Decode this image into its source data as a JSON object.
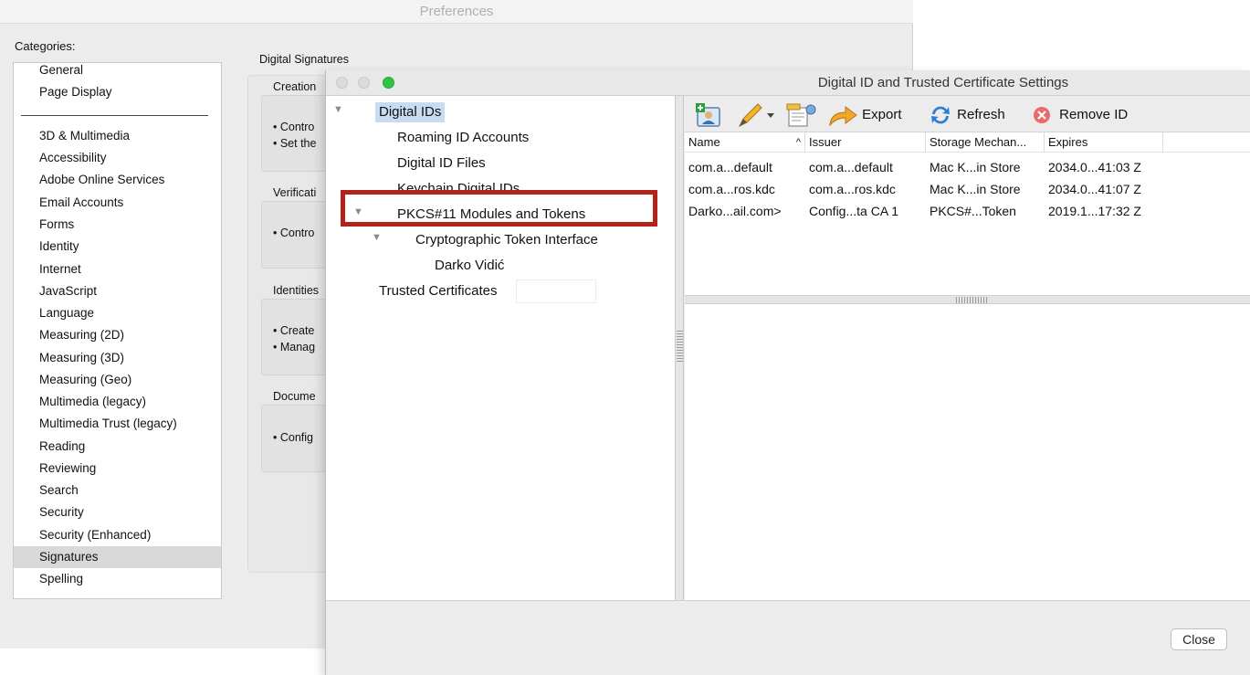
{
  "preferences": {
    "title": "Preferences",
    "categories_label": "Categories:",
    "categories_top": [
      "General",
      "Page Display"
    ],
    "categories": [
      "3D & Multimedia",
      "Accessibility",
      "Adobe Online Services",
      "Email Accounts",
      "Forms",
      "Identity",
      "Internet",
      "JavaScript",
      "Language",
      "Measuring (2D)",
      "Measuring (3D)",
      "Measuring (Geo)",
      "Multimedia (legacy)",
      "Multimedia Trust (legacy)",
      "Reading",
      "Reviewing",
      "Search",
      "Security",
      "Security (Enhanced)",
      "Signatures",
      "Spelling"
    ],
    "selected_category": "Signatures",
    "panel_title": "Digital Signatures",
    "sections": [
      {
        "label": "Creation",
        "bullets": [
          "• Contro",
          "• Set the"
        ]
      },
      {
        "label": "Verificati",
        "bullets": [
          "• Contro"
        ]
      },
      {
        "label": "Identities",
        "bullets": [
          "• Create",
          "• Manag"
        ]
      },
      {
        "label": "Docume",
        "bullets": [
          "• Config"
        ]
      }
    ]
  },
  "dialog": {
    "title": "Digital ID and Trusted Certificate Settings",
    "tree": {
      "digital_ids": "Digital IDs",
      "roaming": "Roaming ID Accounts",
      "files": "Digital ID Files",
      "keychain": "Keychain Digital IDs",
      "pkcs": "PKCS#11 Modules and Tokens",
      "cti": "Cryptographic Token Interface",
      "token_name": "Darko Vidić",
      "trusted": "Trusted Certificates"
    },
    "toolbar": {
      "export": "Export",
      "refresh": "Refresh",
      "remove": "Remove ID"
    },
    "columns": [
      "Name",
      "Issuer",
      "Storage Mechan...",
      "Expires"
    ],
    "rows": [
      [
        "com.a...default",
        "com.a...default",
        "Mac K...in Store",
        "2034.0...41:03 Z"
      ],
      [
        "com.a...ros.kdc",
        "com.a...ros.kdc",
        "Mac K...in Store",
        "2034.0...41:07 Z"
      ],
      [
        "Darko...ail.com>",
        "Config...ta CA 1",
        "PKCS#...Token",
        "2019.1...17:32 Z"
      ]
    ],
    "close_label": "Close"
  }
}
